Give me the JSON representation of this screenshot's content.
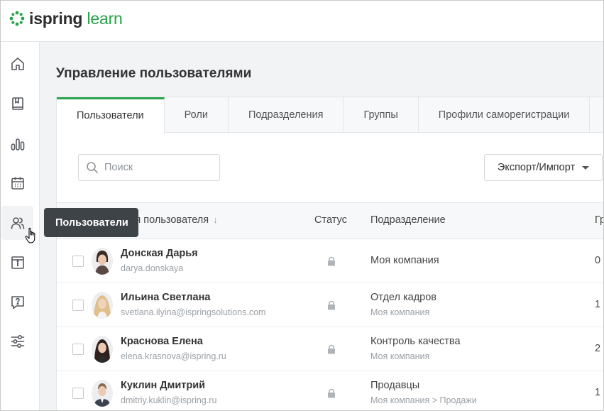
{
  "app": {
    "brand": "ispring",
    "product": "learn",
    "accent_color": "#27a34b"
  },
  "sidebar": {
    "items": [
      {
        "icon": "home-icon"
      },
      {
        "icon": "book-icon"
      },
      {
        "icon": "bar-chart-icon"
      },
      {
        "icon": "calendar-icon"
      },
      {
        "icon": "users-icon",
        "active": true
      },
      {
        "icon": "info-icon"
      },
      {
        "icon": "help-icon"
      },
      {
        "icon": "settings-sliders-icon"
      }
    ],
    "tooltip": "Пользователи"
  },
  "page": {
    "title": "Управление пользователями"
  },
  "tabs": [
    "Пользователи",
    "Роли",
    "Подразделения",
    "Группы",
    "Профили саморегистрации"
  ],
  "toolbar": {
    "search_placeholder": "Поиск",
    "export_label": "Экспорт/Импорт"
  },
  "table": {
    "columns": {
      "user": "Имя пользователя",
      "status": "Статус",
      "department": "Подразделение",
      "groups": "Гр"
    },
    "rows": [
      {
        "name": "Донская Дарья",
        "login": "darya.donskaya",
        "department": "Моя компания",
        "department_path": "",
        "groups": "0"
      },
      {
        "name": "Ильина Светлана",
        "login": "svetlana.ilyina@ispringsolutions.com",
        "department": "Отдел кадров",
        "department_path": "Моя компания",
        "groups": "1"
      },
      {
        "name": "Краснова Елена",
        "login": "elena.krasnova@ispring.ru",
        "department": "Контроль качества",
        "department_path": "Моя компания",
        "groups": "2"
      },
      {
        "name": "Куклин Дмитрий",
        "login": "dmitriy.kuklin@ispring.ru",
        "department": "Продавцы",
        "department_path": "Моя компания > Продажи",
        "groups": "1"
      }
    ]
  }
}
